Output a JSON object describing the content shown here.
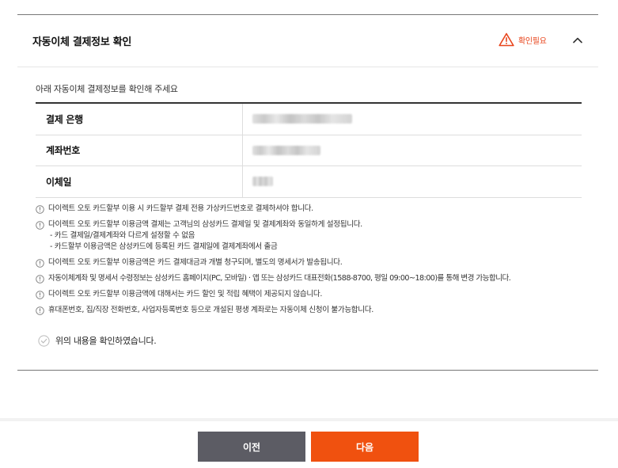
{
  "section": {
    "title": "자동이체 결제정보 확인",
    "status_label": "확인필요",
    "status_color": "#e8441b",
    "warning_icon": "warning-triangle-icon",
    "collapse_icon": "chevron-up-icon"
  },
  "intro_text": "아래 자동이체 결제정보를 확인해 주세요",
  "info_rows": [
    {
      "label": "결제 은행"
    },
    {
      "label": "계좌번호"
    },
    {
      "label": "이체일"
    }
  ],
  "notices": [
    {
      "text": "다이렉트 오토 카드할부 이용 시 카드할부 결제 전용 가상카드번호로 결제하셔야 합니다."
    },
    {
      "text": "다이렉트 오토 카드할부 이용금액 결제는 고객님의 삼성카드 결제일 및 결제계좌와 동일하게 설정됩니다.",
      "sub": [
        "- 카드 결제일/결제계좌와 다르게 설정할 수 없음",
        "- 카드할부 이용금액은 삼성카드에 등록된 카드 결제일에 결제계좌에서 출금"
      ]
    },
    {
      "text": "다이렉트 오토 카드할부 이용금액은 카드 결제대금과 개별 청구되며, 별도의 명세서가 발송됩니다."
    },
    {
      "text": "자동이체계좌 및 명세서 수령정보는 삼성카드 홈페이지(PC, 모바일) · 앱 또는 삼성카드 대표전화(1588-8700, 평일 09:00~18:00)를 통해 변경 가능합니다."
    },
    {
      "text": "다이렉트 오토 카드할부 이용금액에 대해서는 카드 할인 및 적립 혜택이 제공되지 않습니다."
    },
    {
      "text": "휴대폰번호, 집/직장 전화번호, 사업자등록번호 등으로 개설된 평생 계좌로는 자동이체 신청이 불가능합니다."
    }
  ],
  "confirm_label": "위의 내용을 확인하였습니다.",
  "buttons": {
    "prev_label": "이전",
    "next_label": "다음",
    "prev_color": "#5c5c64",
    "next_color": "#f0510f"
  }
}
